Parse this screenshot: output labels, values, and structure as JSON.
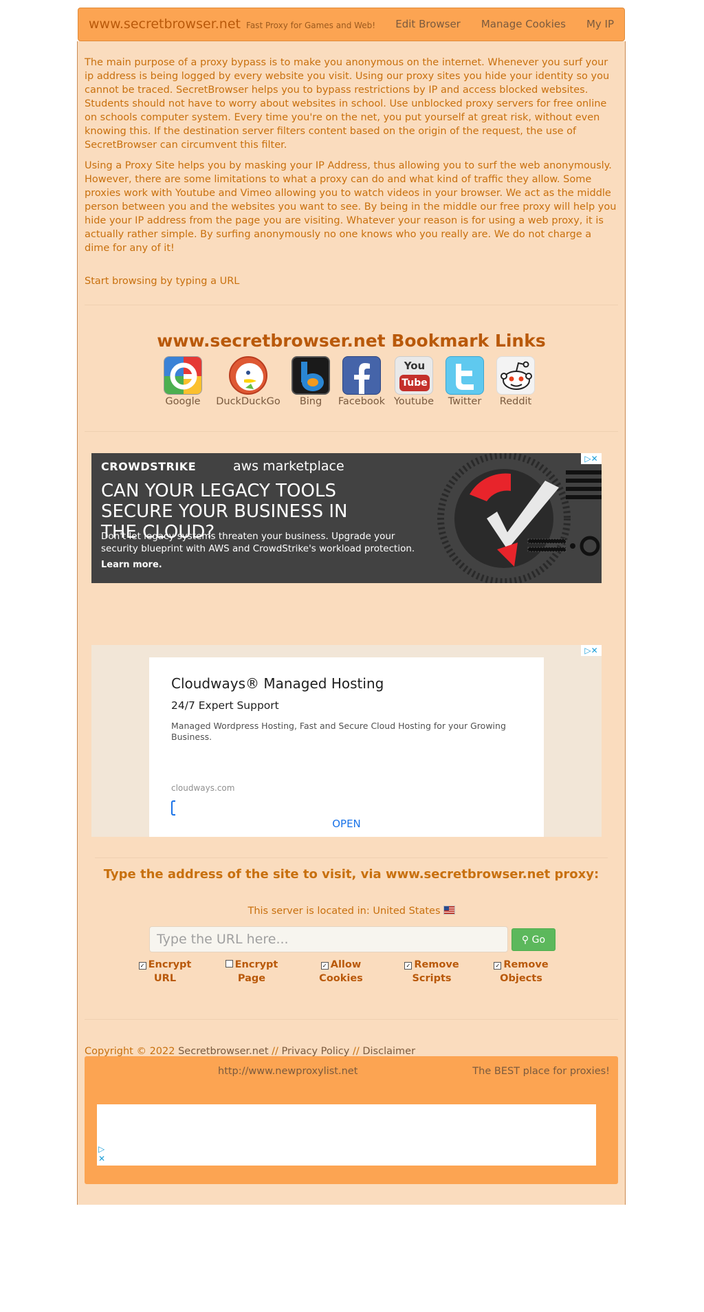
{
  "nav": {
    "brand": "www.secretbrowser.net",
    "tagline": "Fast Proxy for Games and Web!",
    "links": [
      "Edit Browser",
      "Manage Cookies",
      "My IP"
    ]
  },
  "intro": {
    "p1": "The main purpose of a proxy bypass is to make you anonymous on the internet. Whenever you surf your ip address is being logged by every website you visit. Using our proxy sites you hide your identity so you cannot be traced. SecretBrowser helps you to bypass restrictions by IP and access blocked websites. Students should not have to worry about websites in school. Use unblocked proxy servers for free online on schools computer system. Every time you're on the net, you put yourself at great risk, without even knowing this. If the destination server filters content based on the origin of the request, the use of SecretBrowser can circumvent this filter.",
    "p2": "Using a Proxy Site helps you by masking your IP Address, thus allowing you to surf the web anonymously. However, there are some limitations to what a proxy can do and what kind of traffic they allow. Some proxies work with Youtube and Vimeo allowing you to watch videos in your browser. We act as the middle person between you and the websites you want to see. By being in the middle our free proxy will help you hide your IP address from the page you are visiting. Whatever your reason is for using a web proxy, it is actually rather simple. By surfing anonymously no one knows who you really are. We do not charge a dime for any of it!",
    "start": "Start browsing by typing a URL"
  },
  "bookmarks": {
    "title": "www.secretbrowser.net Bookmark Links",
    "items": [
      {
        "label": "Google",
        "icon": "google-icon"
      },
      {
        "label": "DuckDuckGo",
        "icon": "duckduckgo-icon"
      },
      {
        "label": "Bing",
        "icon": "bing-icon"
      },
      {
        "label": "Facebook",
        "icon": "facebook-icon"
      },
      {
        "label": "Youtube",
        "icon": "youtube-icon"
      },
      {
        "label": "Twitter",
        "icon": "twitter-icon"
      },
      {
        "label": "Reddit",
        "icon": "reddit-icon"
      }
    ],
    "youtube_you": "You",
    "youtube_tube": "Tube"
  },
  "ad1": {
    "brand": "CROWDSTRIKE",
    "partner": "aws marketplace",
    "headline": "CAN YOUR LEGACY TOOLS SECURE YOUR BUSINESS IN THE CLOUD?",
    "body": "Don't let legacy systems threaten your business. Upgrade your security blueprint with AWS and CrowdStrike's workload protection.",
    "cta": "Learn more."
  },
  "ad2": {
    "title": "Cloudways® Managed Hosting",
    "subtitle": "24/7 Expert Support",
    "description": "Managed Wordpress Hosting, Fast and Secure Cloud Hosting for your Growing Business.",
    "url": "cloudways.com",
    "button": "OPEN"
  },
  "proxy": {
    "title": "Type the address of the site to visit, via www.secretbrowser.net proxy:",
    "location_label": "This server is located in:",
    "location_value": "United States",
    "placeholder": "Type the URL here...",
    "go": "Go",
    "options": [
      {
        "line1": "Encrypt",
        "line2": "URL",
        "checked": true
      },
      {
        "line1": "Encrypt",
        "line2": "Page",
        "checked": false
      },
      {
        "line1": "Allow",
        "line2": "Cookies",
        "checked": true
      },
      {
        "line1": "Remove",
        "line2": "Scripts",
        "checked": true
      },
      {
        "line1": "Remove",
        "line2": "Objects",
        "checked": true
      }
    ]
  },
  "footer": {
    "copyright": "Copyright © 2022",
    "site_link": "Secretbrowser.net",
    "sep1": "//",
    "privacy": "Privacy Policy",
    "sep2": "//",
    "disclaimer": "Disclaimer",
    "left_link": "http://www.newproxylist.net",
    "right_text": "The BEST place for proxies!"
  },
  "colors": {
    "brand_orange": "#fca452",
    "panel_bg": "#fadcbe",
    "text_orange": "#c8700e",
    "go_green": "#5cb85c"
  }
}
